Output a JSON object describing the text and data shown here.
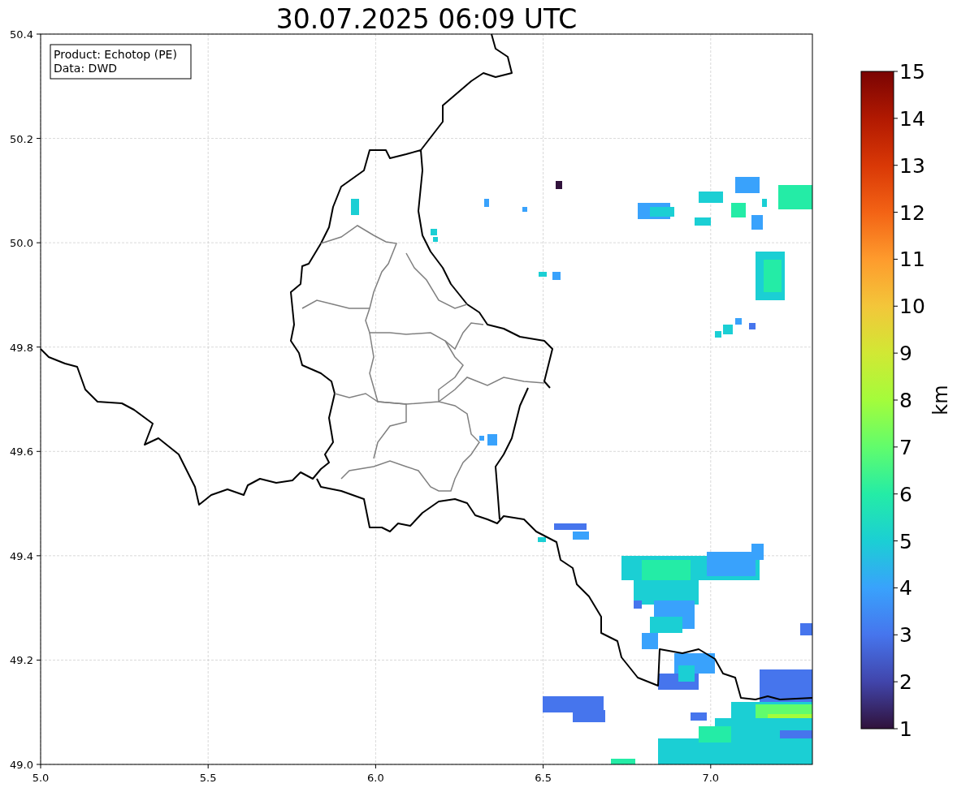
{
  "title": "30.07.2025 06:09 UTC",
  "legend": [
    "Product: Echotop (PE)",
    "Data: DWD"
  ],
  "x_ticks": [
    "5.0",
    "5.5",
    "6.0",
    "6.5",
    "7.0"
  ],
  "y_ticks": [
    "50.4",
    "50.2",
    "50.0",
    "49.8",
    "49.6",
    "49.4",
    "49.2",
    "49.0"
  ],
  "colorbar": {
    "label": "km",
    "ticks": [
      "15",
      "14",
      "13",
      "12",
      "11",
      "10",
      "9",
      "8",
      "7",
      "6",
      "5",
      "4",
      "3",
      "2",
      "1"
    ]
  }
}
